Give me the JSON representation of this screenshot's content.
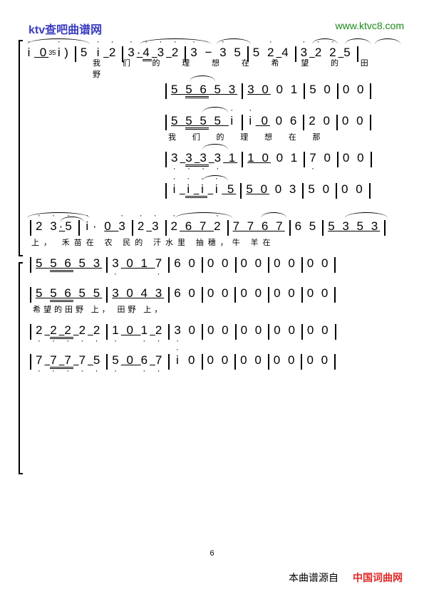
{
  "header": {
    "left": "ktv查吧曲谱网",
    "right": "www.ktvc8.com"
  },
  "footer": {
    "source_label": "本曲谱源自",
    "source_site": "中国词曲网",
    "page_number": "6"
  },
  "sys1_melody": {
    "m1": "i 0",
    "m1_grace": "3̇5̇",
    "m1b": "i )",
    "m2": "5 i 2̇",
    "m3": "3̇·4̇ 3̇ 2̇",
    "m4": "3̇  −  3̇  5",
    "m5": "5 2̇ 4",
    "m6": "3̇ 2̇ 2̇ 5"
  },
  "sys1_lyric": "我 们 的 理     想       在   希 望 的 田 野",
  "sys2": {
    "p1": {
      "m1": "5 5 6 5 3",
      "m2": "3 0 0 1",
      "m3": "5 0",
      "m4": "0  0"
    },
    "p2": {
      "m1": "5 5 5 5 i",
      "m2": "i 0 0 6",
      "m3": "2 0",
      "m4": "0  0"
    },
    "p2_lyric": "我 们 的 理    想    在 那",
    "p3": {
      "m1": "3 3 3 3 1",
      "m2": "1 0 0 1",
      "m3": "7 0",
      "m4": "0  0"
    },
    "p4": {
      "m1": "i i i i 5",
      "m2": "5 0 0 3",
      "m3": "5 0",
      "m4": "0  0"
    }
  },
  "sys3_melody": {
    "m1": "2̇   3̇·5̇",
    "m2": "i·   0 3̇",
    "m3": "2̇ 3̇",
    "m4": "2̇ 6 7 2̇",
    "m5": "7 7 6 7",
    "m6": "6  5",
    "m7": "5 3 5 3"
  },
  "sys3_lyric": "上，         禾苗在 农 民的 汗水里 抽穗，牛 羊在",
  "sys4": {
    "p1": {
      "m1": "5 5 6 5 3",
      "m2": "3 0 1 7",
      "m3": "6 0",
      "m4": "0  0",
      "m5": "0  0",
      "m6": "0 0",
      "m7": "0  0"
    },
    "p2": {
      "m1": "5 5 6 5 5",
      "m2": "3 0 4 3",
      "m3": "6 0",
      "m4": "0  0",
      "m5": "0  0",
      "m6": "0 0",
      "m7": "0  0"
    },
    "p2_lyric": "希望的田野 上， 田野 上，",
    "p3": {
      "m1": "2 2 2 2 2",
      "m2": "1 0 1 2",
      "m3": "3 0",
      "m4": "0  0",
      "m5": "0  0",
      "m6": "0 0",
      "m7": "0  0"
    },
    "p4": {
      "m1": "7 7 7 7 5",
      "m2": "5 0 6 7",
      "m3": "i 0",
      "m4": "0  0",
      "m5": "0  0",
      "m6": "0 0",
      "m7": "0  0"
    }
  }
}
